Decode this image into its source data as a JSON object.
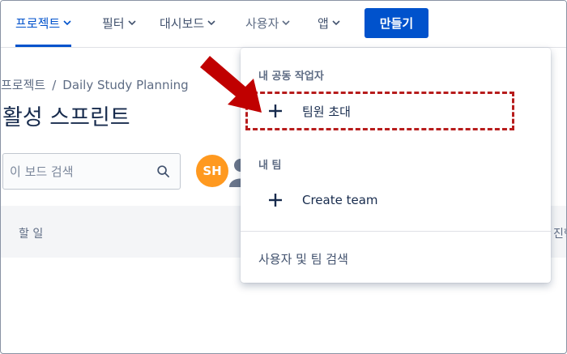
{
  "nav": {
    "items": [
      {
        "label": "프로젝트",
        "active": true
      },
      {
        "label": "필터"
      },
      {
        "label": "대시보드"
      },
      {
        "label": "사용자"
      },
      {
        "label": "앱"
      }
    ],
    "create_label": "만들기"
  },
  "breadcrumb": {
    "root": "프로젝트",
    "separator": "/",
    "project": "Daily Study Planning"
  },
  "page": {
    "title": "활성 스프린트"
  },
  "search": {
    "placeholder": "이 보드 검색",
    "icon": "search-icon"
  },
  "avatar": {
    "initials": "SH",
    "color": "#ff991f"
  },
  "board": {
    "columns": [
      "할 일",
      "진행"
    ]
  },
  "dropdown": {
    "section_collaborators": "내 공동 작업자",
    "invite_label": "팀원 초대",
    "section_teams": "내 팀",
    "create_team_label": "Create team",
    "search_label": "사용자 및 팀 검색"
  },
  "colors": {
    "brand": "#0052cc",
    "highlight": "#b71c1c",
    "arrow": "#c00000"
  }
}
